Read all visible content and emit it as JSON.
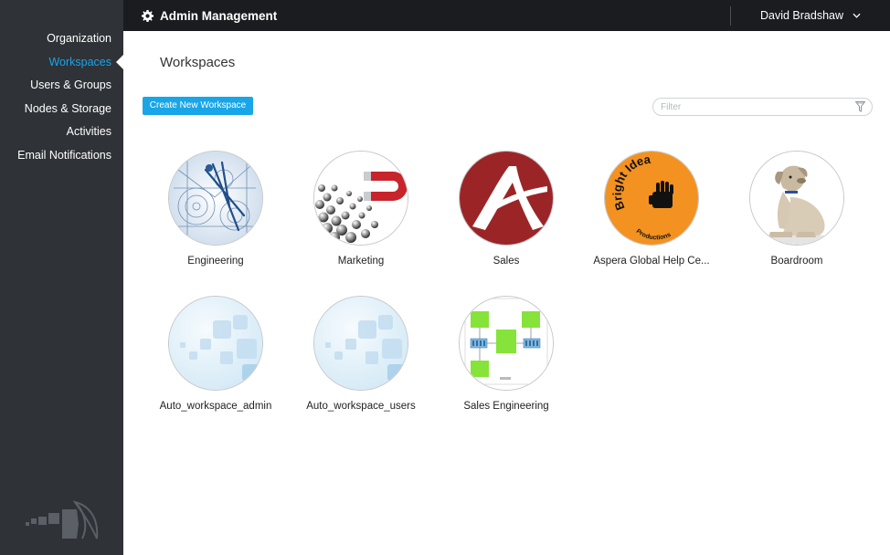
{
  "header": {
    "app_title": "Admin Management",
    "user_name": "David Bradshaw"
  },
  "sidebar": {
    "items": [
      {
        "label": "Organization",
        "active": false
      },
      {
        "label": "Workspaces",
        "active": true
      },
      {
        "label": "Users & Groups",
        "active": false
      },
      {
        "label": "Nodes & Storage",
        "active": false
      },
      {
        "label": "Activities",
        "active": false
      },
      {
        "label": "Email Notifications",
        "active": false
      }
    ]
  },
  "main": {
    "title": "Workspaces",
    "create_button_label": "Create New Workspace",
    "filter_placeholder": "Filter",
    "filter_value": "",
    "workspaces": [
      {
        "name": "Engineering",
        "icon": "blueprint-image"
      },
      {
        "name": "Marketing",
        "icon": "magnet-image"
      },
      {
        "name": "Sales",
        "icon": "aspera-logo-image"
      },
      {
        "name": "Aspera Global Help Ce...",
        "icon": "bright-idea-logo-image"
      },
      {
        "name": "Boardroom",
        "icon": "dog-image"
      },
      {
        "name": "Auto_workspace_admin",
        "icon": "default-workspace-image"
      },
      {
        "name": "Auto_workspace_users",
        "icon": "default-workspace-image"
      },
      {
        "name": "Sales Engineering",
        "icon": "network-diagram-image"
      }
    ],
    "logo_texts": {
      "bright_idea": "Bright Idea",
      "productions": "Productions"
    }
  },
  "colors": {
    "accent": "#19a6e8",
    "sidebar_bg": "#2f3237",
    "topbar_bg": "#1b1c1f",
    "aspera_red": "#9b2526",
    "bright_idea_orange": "#f39220"
  }
}
